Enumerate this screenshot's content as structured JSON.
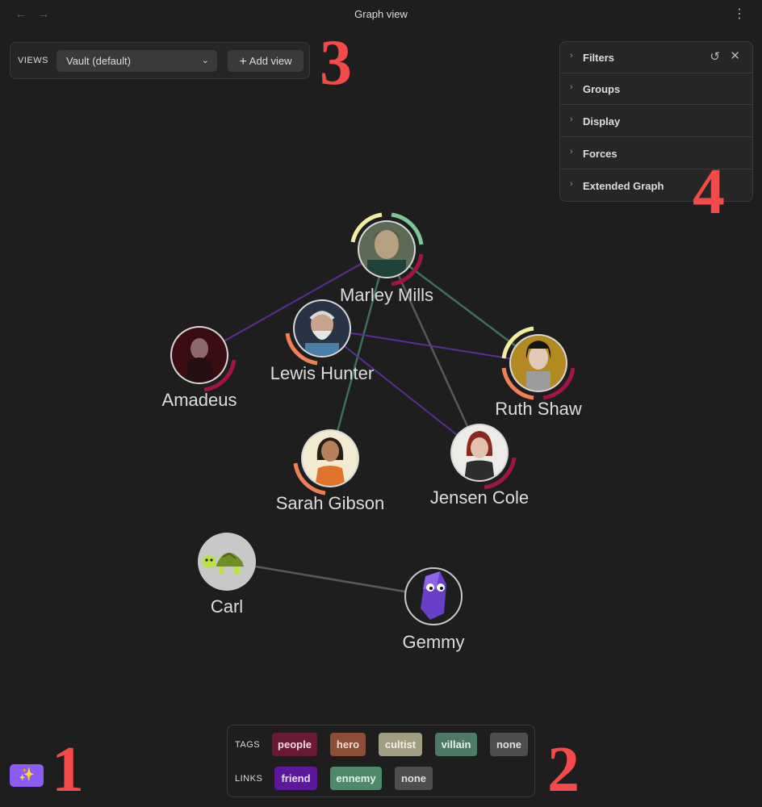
{
  "titlebar": {
    "back_icon": "arrow-left-icon",
    "forward_icon": "arrow-right-icon",
    "title": "Graph view",
    "more_icon": "more-vertical-icon"
  },
  "views": {
    "label": "VIEWS",
    "selected": "Vault (default)",
    "add_label": "Add view"
  },
  "settings": {
    "sections": [
      "Filters",
      "Groups",
      "Display",
      "Forces",
      "Extended Graph"
    ],
    "reset_icon": "rotate-ccw-icon",
    "close_icon": "close-icon"
  },
  "graph": {
    "nodes": [
      {
        "label": "Marley Mills"
      },
      {
        "label": "Lewis Hunter"
      },
      {
        "label": "Amadeus"
      },
      {
        "label": "Ruth Shaw"
      },
      {
        "label": "Sarah Gibson"
      },
      {
        "label": "Jensen Cole"
      },
      {
        "label": "Carl"
      },
      {
        "label": "Gemmy"
      }
    ]
  },
  "legend": {
    "tags_label": "TAGS",
    "tags": [
      {
        "label": "people",
        "bg": "#6b1a33"
      },
      {
        "label": "hero",
        "bg": "#8e4e36"
      },
      {
        "label": "cultist",
        "bg": "#a19e84"
      },
      {
        "label": "villain",
        "bg": "#4f7a68"
      },
      {
        "label": "none",
        "bg": "#4e4e4e"
      }
    ],
    "links_label": "LINKS",
    "links": [
      {
        "label": "friend",
        "bg": "#5c1899"
      },
      {
        "label": "ennemy",
        "bg": "#4e8a6a"
      },
      {
        "label": "none",
        "bg": "#4e4e4e"
      }
    ]
  },
  "ai_button_icon": "sparkles-icon",
  "markers": [
    "1",
    "2",
    "3",
    "4"
  ],
  "colors": {
    "background": "#1e1e1e",
    "accent": "#8b5cf6",
    "marker": "#f44a4a"
  }
}
